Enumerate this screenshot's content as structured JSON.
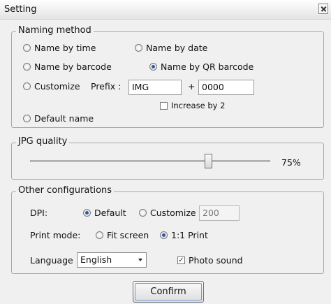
{
  "window": {
    "title": "Setting"
  },
  "naming": {
    "legend": "Naming method",
    "options": {
      "by_time": "Name by time",
      "by_date": "Name by date",
      "by_barcode": "Name by barcode",
      "by_qr_barcode": "Name by QR barcode",
      "customize": "Customize",
      "default_name": "Default name"
    },
    "selected": "by_qr_barcode",
    "prefix_label": "Prefix :",
    "prefix_value": "IMG",
    "plus_label": "+",
    "counter_value": "0000",
    "increase_label": "Increase by 2",
    "increase_checked": false
  },
  "jpg": {
    "legend": "JPG quality",
    "value_label": "75%",
    "value": 75
  },
  "other": {
    "legend": "Other configurations",
    "dpi_label": "DPI:",
    "dpi_default": "Default",
    "dpi_customize": "Customize",
    "dpi_selected": "default",
    "dpi_value": "200",
    "print_mode_label": "Print mode:",
    "print_fit": "Fit screen",
    "print_one": "1:1 Print",
    "print_selected": "one_to_one",
    "language_label": "Language",
    "language_value": "English",
    "photo_sound_label": "Photo sound",
    "photo_sound_checked": true
  },
  "confirm_label": "Confirm",
  "icons": {
    "close": "close-icon",
    "dropdown": "chevron-down-icon"
  }
}
